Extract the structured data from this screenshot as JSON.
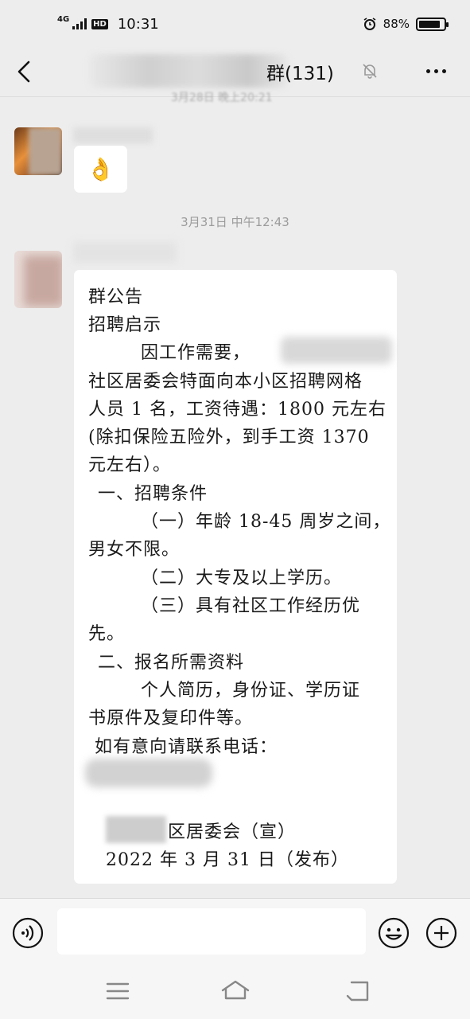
{
  "status_bar": {
    "network": "4G",
    "hd": "HD",
    "time": "10:31",
    "battery": "88%",
    "battery_level": 0.88
  },
  "header": {
    "title": "群(131)"
  },
  "chat": {
    "message1_emoji": "👌",
    "timestamp": "3月31日 中午12:43",
    "notice_lines": [
      "群公告",
      "招聘启示",
      "因工作需要，",
      "社区居委会特面向本小区招聘网格",
      "人员 1 名，工资待遇：1800 元左右",
      "(除扣保险五险外，到手工资 1370",
      "元左右）。",
      "一、招聘条件",
      "（一）年龄 18-45 周岁之间，",
      "男女不限。",
      "（二）大专及以上学历。",
      "（三）具有社区工作经历优",
      "先。",
      "二、报名所需资料",
      "个人简历，身份证、学历证",
      "书原件及复印件等。",
      "如有意向请联系电话：",
      "区居委会（宣）",
      "2022 年 3 月 31 日（发布）"
    ]
  },
  "input": {
    "placeholder": ""
  },
  "icons": {
    "back": "back-arrow-icon",
    "mute": "bell-muted-icon",
    "more": "more-dots-icon",
    "voice": "voice-icon",
    "emoji": "emoji-icon",
    "plus": "plus-icon",
    "menu": "menu-icon",
    "home": "home-icon",
    "back_nav": "back-nav-icon"
  }
}
